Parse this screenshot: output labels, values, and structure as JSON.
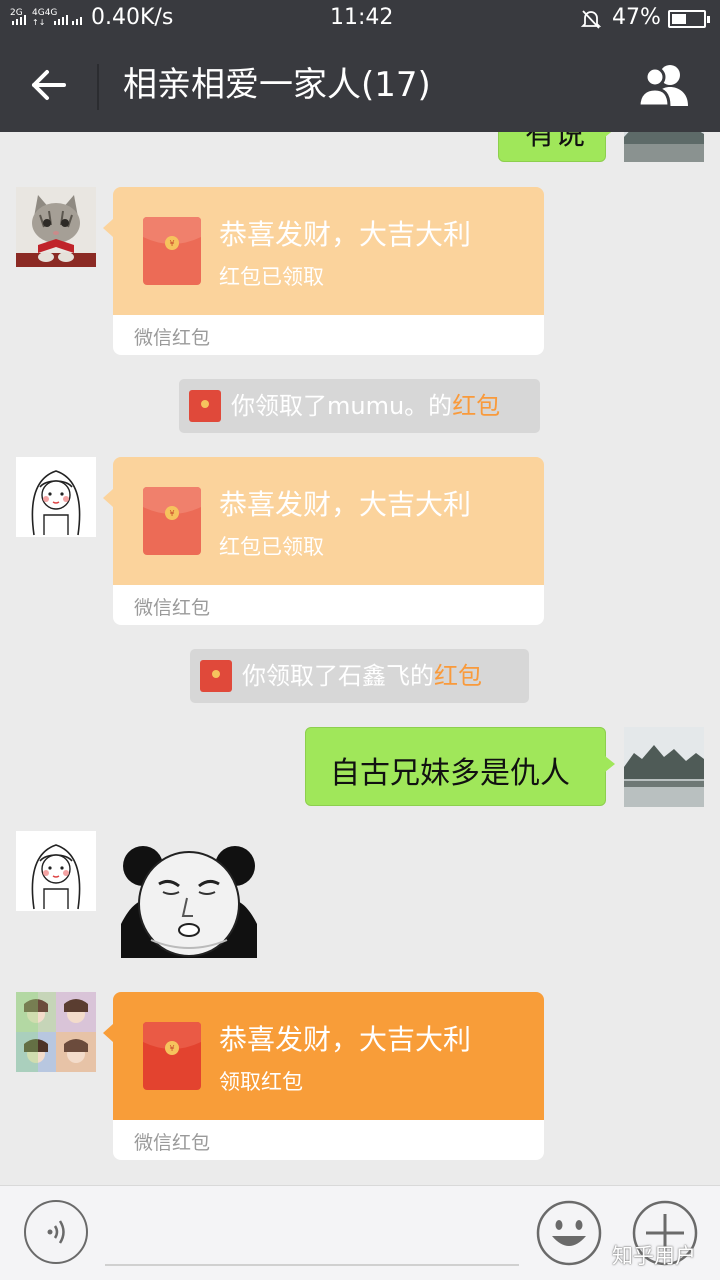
{
  "status_bar": {
    "signal_text": "2G 4G 4G",
    "speed": "0.40K/s",
    "time": "11:42",
    "battery": "47%",
    "battery_level": 0.47
  },
  "header": {
    "title": "相亲相爱一家人(17)",
    "back_icon": "arrow-left-icon",
    "group_icon": "group-members-icon"
  },
  "messages": {
    "top_partial_text": "有说",
    "hongbao_1": {
      "title": "恭喜发财，大吉大利",
      "status": "红包已领取",
      "brand": "微信红包"
    },
    "system_1": {
      "prefix": "你领取了mumu。的",
      "link": "红包"
    },
    "hongbao_2": {
      "title": "恭喜发财，大吉大利",
      "status": "红包已领取",
      "brand": "微信红包"
    },
    "system_2": {
      "prefix": "你领取了石鑫飞的",
      "link": "红包"
    },
    "outgoing_text": "自古兄妹多是仇人",
    "hongbao_3": {
      "title": "恭喜发财，大吉大利",
      "status": "领取红包",
      "brand": "微信红包"
    }
  },
  "input_bar": {
    "voice_icon": "voice-icon",
    "emoji_icon": "emoji-icon",
    "plus_icon": "plus-icon"
  },
  "watermark": "知乎用户",
  "colors": {
    "header_bg": "#393a3f",
    "chat_bg": "#ebebeb",
    "green_bubble": "#a0e75a",
    "hongbao_opened": "#fbd39c",
    "hongbao_unopened": "#f89d39",
    "hongbao_link": "#f99a3b"
  }
}
